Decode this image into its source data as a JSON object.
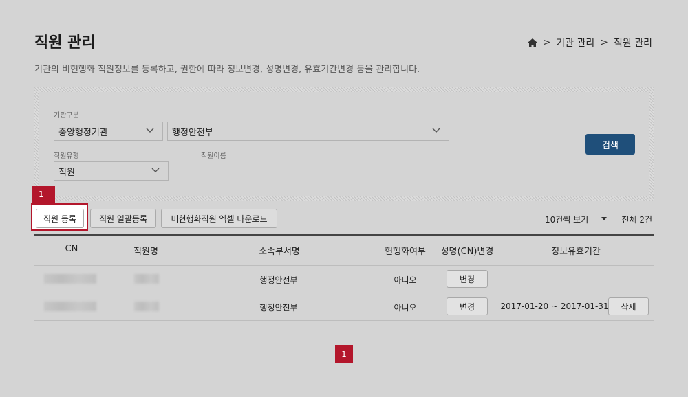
{
  "header": {
    "title": "직원 관리",
    "description": "기관의 비현행화 직원정보를 등록하고, 권한에 따라 정보변경, 성명변경, 유효기간변경 등을 관리합니다.",
    "breadcrumb": [
      ">",
      "기관 관리",
      ">",
      "직원 관리"
    ]
  },
  "search": {
    "org_type_label": "기관구분",
    "org_type_value": "중앙행정기관",
    "org_value": "행정안전부",
    "staff_type_label": "직원유형",
    "staff_type_value": "직원",
    "staff_name_label": "직원이름",
    "staff_name_value": "",
    "search_button": "검색"
  },
  "toolbar": {
    "marker": "1",
    "register": "직원 등록",
    "bulk_register": "직원 일괄등록",
    "excel_download": "비현행화직원 엑셀 다운로드",
    "per_page": "10건씩 보기",
    "total": "전체 2건"
  },
  "table": {
    "headers": [
      "CN",
      "직원명",
      "소속부서명",
      "현행화여부",
      "성명(CN)변경",
      "정보유효기간"
    ],
    "rows": [
      {
        "dept": "행정안전부",
        "current": "아니오",
        "change": "변경",
        "period": "",
        "delete": ""
      },
      {
        "dept": "행정안전부",
        "current": "아니오",
        "change": "변경",
        "period": "2017-01-20 ~ 2017-01-31",
        "delete": "삭제"
      }
    ]
  },
  "pagination": {
    "current": "1"
  },
  "colors": {
    "accent": "#b3162b",
    "primary": "#1f4f7a",
    "background": "#d4d4d4"
  }
}
